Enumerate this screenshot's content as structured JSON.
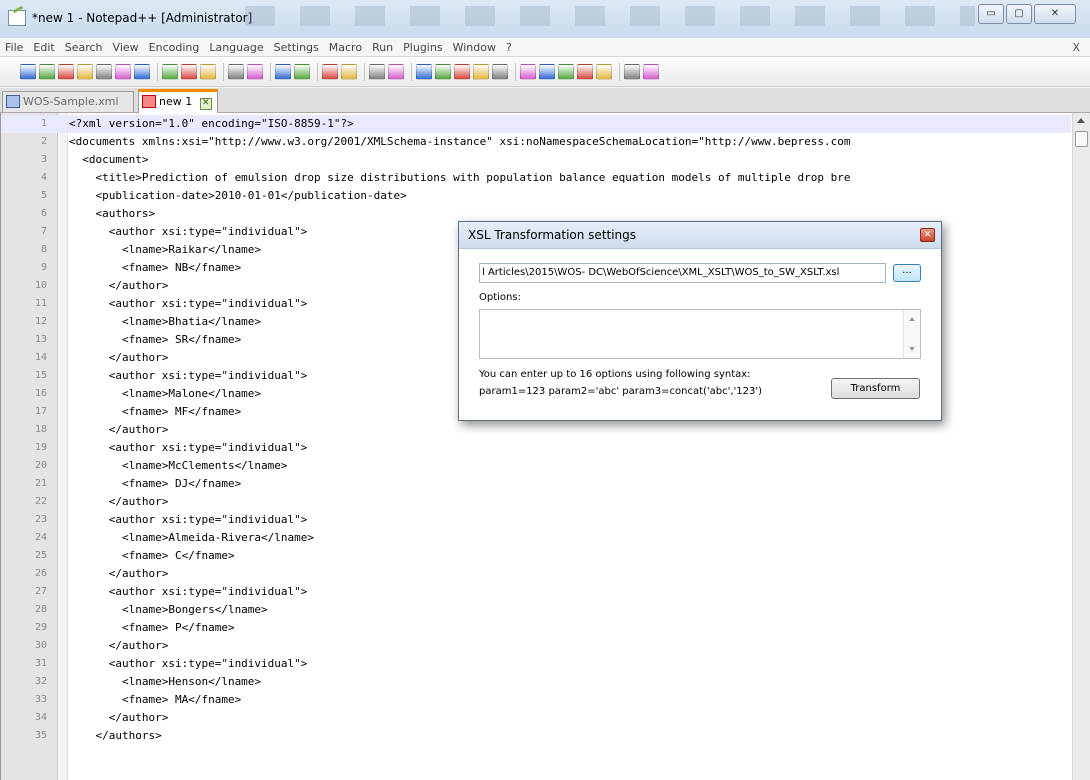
{
  "window": {
    "title": "*new 1 - Notepad++ [Administrator]",
    "buttons": {
      "minimize": "▭",
      "maximize": "▢",
      "close": "✕"
    }
  },
  "menu": {
    "items": [
      "File",
      "Edit",
      "Search",
      "View",
      "Encoding",
      "Language",
      "Settings",
      "Macro",
      "Run",
      "Plugins",
      "Window",
      "?"
    ],
    "close": "X"
  },
  "toolbar": {
    "icons": [
      "new-file-icon",
      "open-file-icon",
      "save-icon",
      "save-all-icon",
      "close-icon",
      "close-all-icon",
      "print-icon",
      "|",
      "cut-icon",
      "copy-icon",
      "paste-icon",
      "|",
      "undo-icon",
      "redo-icon",
      "|",
      "find-icon",
      "replace-icon",
      "|",
      "zoom-in-icon",
      "zoom-out-icon",
      "|",
      "sync-vertical-icon",
      "sync-horizontal-icon",
      "|",
      "word-wrap-icon",
      "all-chars-icon",
      "indent-guide-icon",
      "user-lang-icon",
      "function-list-icon",
      "|",
      "record-macro-icon",
      "stop-macro-icon",
      "play-macro-icon",
      "run-macro-multi-icon",
      "save-macro-icon",
      "|",
      "spell-check-icon",
      "xml-tools-icon"
    ],
    "colors": {
      "page": "#ffffff",
      "blue": "#2f6bd4",
      "green": "#4fa63b",
      "red": "#d7443c",
      "yellow": "#e3b53a",
      "gray": "#7d7d7d",
      "pink": "#d45ccf"
    }
  },
  "tabs": [
    {
      "label": "WOS-Sample.xml",
      "close": "✕"
    },
    {
      "label": "new 1",
      "close": "✕"
    }
  ],
  "editor": {
    "current_line": 1,
    "lines": [
      "<?xml version=\"1.0\" encoding=\"ISO-8859-1\"?>",
      "<documents xmlns:xsi=\"http://www.w3.org/2001/XMLSchema-instance\" xsi:noNamespaceSchemaLocation=\"http://www.bepress.com",
      "  <document>",
      "    <title>Prediction of emulsion drop size distributions with population balance equation models of multiple drop bre",
      "    <publication-date>2010-01-01</publication-date>",
      "    <authors>",
      "      <author xsi:type=\"individual\">",
      "        <lname>Raikar</lname>",
      "        <fname> NB</fname>",
      "      </author>",
      "      <author xsi:type=\"individual\">",
      "        <lname>Bhatia</lname>",
      "        <fname> SR</fname>",
      "      </author>",
      "      <author xsi:type=\"individual\">",
      "        <lname>Malone</lname>",
      "        <fname> MF</fname>",
      "      </author>",
      "      <author xsi:type=\"individual\">",
      "        <lname>McClements</lname>",
      "        <fname> DJ</fname>",
      "      </author>",
      "      <author xsi:type=\"individual\">",
      "        <lname>Almeida-Rivera</lname>",
      "        <fname> C</fname>",
      "      </author>",
      "      <author xsi:type=\"individual\">",
      "        <lname>Bongers</lname>",
      "        <fname> P</fname>",
      "      </author>",
      "      <author xsi:type=\"individual\">",
      "        <lname>Henson</lname>",
      "        <fname> MA</fname>",
      "      </author>",
      "    </authors>"
    ]
  },
  "dialog": {
    "title": "XSL Transformation settings",
    "xsl_path": "l Articles\\2015\\WOS- DC\\WebOfScience\\XML_XSLT\\WOS_to_SW_XSLT.xsl",
    "browse_label": "...",
    "options_label": "Options:",
    "options_value": "",
    "hint_line1": "You can enter up to 16 options using following syntax:",
    "hint_line2": "param1=123 param2='abc' param3=concat('abc','123')",
    "transform_label": "Transform"
  }
}
